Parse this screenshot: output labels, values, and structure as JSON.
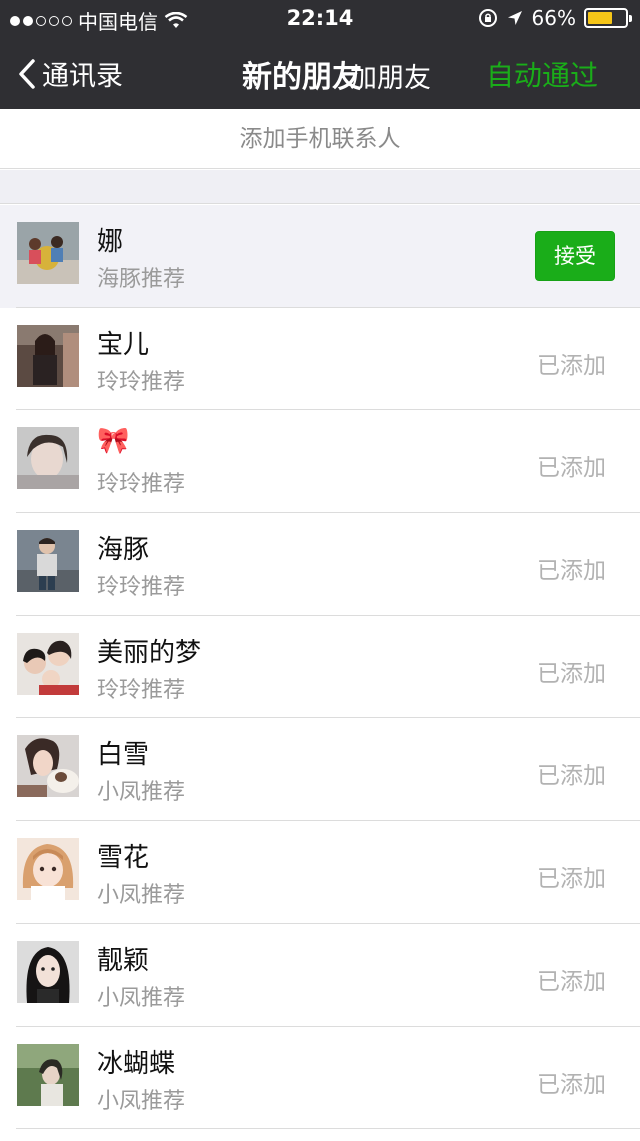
{
  "status_bar": {
    "carrier": "中国电信",
    "time": "22:14",
    "battery": "66%",
    "battery_level": 0.66
  },
  "nav": {
    "back_label": "通讯录",
    "title": "新的朋友",
    "add_friend": "加朋友",
    "auto_pass": "自动通过"
  },
  "add_phone_label": "添加手机联系人",
  "colors": {
    "accent": "#1aad19",
    "header": "#2f2f33"
  },
  "friends": [
    {
      "name": "娜",
      "source": "海豚推荐",
      "action": "接受"
    },
    {
      "name": "宝儿",
      "source": "玲玲推荐",
      "status": "已添加"
    },
    {
      "name": "🎀",
      "source": "玲玲推荐",
      "status": "已添加"
    },
    {
      "name": "海豚",
      "source": "玲玲推荐",
      "status": "已添加"
    },
    {
      "name": "美丽的梦",
      "source": "玲玲推荐",
      "status": "已添加"
    },
    {
      "name": "白雪",
      "source": "小凤推荐",
      "status": "已添加"
    },
    {
      "name": "雪花",
      "source": "小凤推荐",
      "status": "已添加"
    },
    {
      "name": "靓颖",
      "source": "小凤推荐",
      "status": "已添加"
    },
    {
      "name": "冰蝴蝶",
      "source": "小凤推荐",
      "status": "已添加"
    }
  ]
}
